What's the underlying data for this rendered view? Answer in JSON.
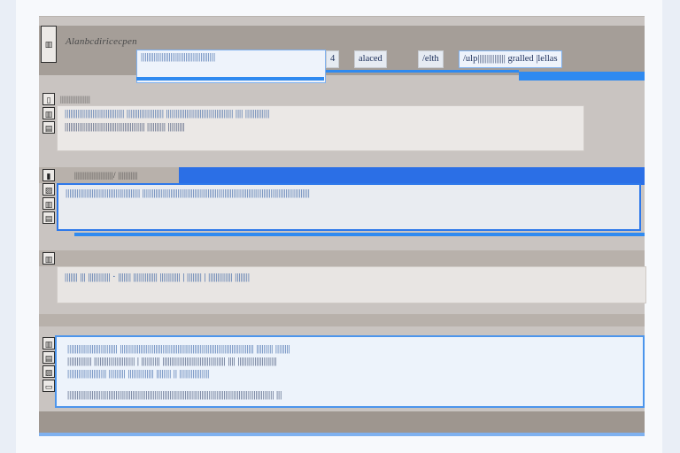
{
  "window": {
    "title": "Alanbcdiricecpen"
  },
  "toolbar": {
    "field_text": "||||||||||||||||||||||||||||||||||||||||",
    "tabs": [
      "4",
      "alaced",
      "/elth",
      "/ulp||||||||||||||| gralled |lellas"
    ]
  },
  "panels": {
    "panel2": {
      "label": "|||||||||||||||||",
      "glyphs": [
        "▯",
        "▥",
        "▤"
      ],
      "lines": [
        "|||||||||||||||||||||||||||||||| |||||||||||||||||||| |||||||||||||||||||||||||||||||||||| |||| |||||||||||||",
        "||||||||||||||||||||||||||||||||||||||||||| |||||||||| |||||||||"
      ]
    },
    "panel3": {
      "label": "||||||||||||||||||||||/ |||||||||||",
      "glyphs": [
        "▮",
        "▨",
        "▥",
        "▤"
      ],
      "lines": [
        "|||||||||||||||||||||||||||||||||||||||| ||||||||||||||||||||||||||||||||||||||||||||||||||||||||||||||||||||||||||||||||||||||||||"
      ]
    },
    "panel4": {
      "label": "",
      "glyphs": [
        "▥"
      ],
      "lines": [
        "||||||| ||| |||||||||||| · ||||||| ||||||||||||| ||||||||||| | |||||||| | ||||||||||||| ||||||||"
      ]
    },
    "panel5": {
      "label": "",
      "glyphs": [
        "▥",
        "▤",
        "▨",
        "▭"
      ],
      "lines": [
        "||||||||||||||||||||||||||| |||||||||||||||||||||||||||||||||||||||||||||||||||||||||||||||||||||||| ||||||||| ||||||||",
        "||||||||||||| |||||||||||||||||||||| | |||||||||| |||||||||||||||||||||||||||||||||| |||| |||||||||||||||||||||",
        "||||||||||||||||||||| ||||||||| |||||||||||||| |||||||| || ||||||||||||||||",
        "||||||||||||||||||||||||||||||||||||||||||||||||||||||||||||||||||||||||||||||||||||||||||||||||||||||||||||||| |||"
      ]
    }
  },
  "colors": {
    "accent": "#2f8af0",
    "panel_bg": "#c9c4c1",
    "header_band": "#a59e98",
    "text_blue": "#1f4f9a"
  }
}
